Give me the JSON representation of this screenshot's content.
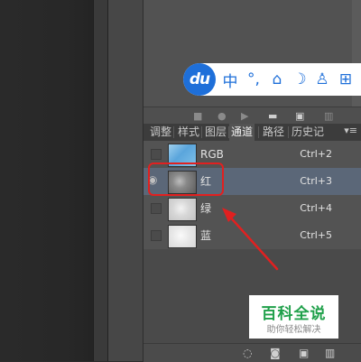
{
  "ime": {
    "logo_text": "du",
    "items": [
      "中",
      "°,",
      "⌂",
      "☽",
      "♙",
      "⊞"
    ],
    "icon_names": [
      "chinese-mode-icon",
      "punctuation-icon",
      "toolbox-icon",
      "moon-icon",
      "user-icon",
      "grid-icon"
    ],
    "accent": "#1e6fd9"
  },
  "tabs": [
    {
      "label": "调整"
    },
    {
      "label": "样式"
    },
    {
      "label": "图层"
    },
    {
      "label": "通道",
      "active": true
    },
    {
      "label": "路径"
    },
    {
      "label": "历史记"
    }
  ],
  "channels": [
    {
      "name": "RGB",
      "shortcut": "Ctrl+2",
      "visible": false,
      "selected": false,
      "thumb": "rgb"
    },
    {
      "name": "红",
      "shortcut": "Ctrl+3",
      "visible": true,
      "selected": true,
      "thumb": "red"
    },
    {
      "name": "绿",
      "shortcut": "Ctrl+4",
      "visible": false,
      "selected": false,
      "thumb": "green"
    },
    {
      "name": "蓝",
      "shortcut": "Ctrl+5",
      "visible": false,
      "selected": false,
      "thumb": "blue"
    }
  ],
  "watermark": {
    "title": "百科全说",
    "subtitle": "助你轻松解决"
  },
  "colors": {
    "highlight_box": "#e12020",
    "selected_row": "#5b6778",
    "watermark_green": "#1fa04a"
  }
}
